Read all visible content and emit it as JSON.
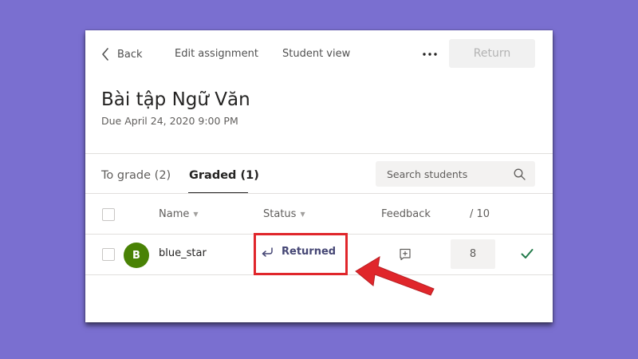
{
  "header": {
    "back_label": "Back",
    "edit_assignment_label": "Edit assignment",
    "student_view_label": "Student view",
    "return_label": "Return"
  },
  "assignment": {
    "title": "Bài tập Ngữ Văn",
    "due": "Due April 24, 2020 9:00 PM"
  },
  "tabs": [
    {
      "label": "To grade (2)",
      "active": false
    },
    {
      "label": "Graded (1)",
      "active": true
    }
  ],
  "search": {
    "placeholder": "Search students"
  },
  "table": {
    "columns": {
      "name": "Name",
      "status": "Status",
      "feedback": "Feedback",
      "points": "/ 10"
    },
    "rows": [
      {
        "avatar_initial": "B",
        "name": "blue_star",
        "status": "Returned",
        "grade": "8"
      }
    ]
  },
  "colors": {
    "background": "#7a6fd0",
    "avatar": "#498205",
    "status_text": "#464775",
    "check": "#237b4b",
    "highlight": "#e0262b"
  },
  "icons": [
    "chevron-left-icon",
    "more-horizontal-icon",
    "search-icon",
    "return-arrow-icon",
    "add-feedback-icon",
    "checkmark-icon"
  ]
}
